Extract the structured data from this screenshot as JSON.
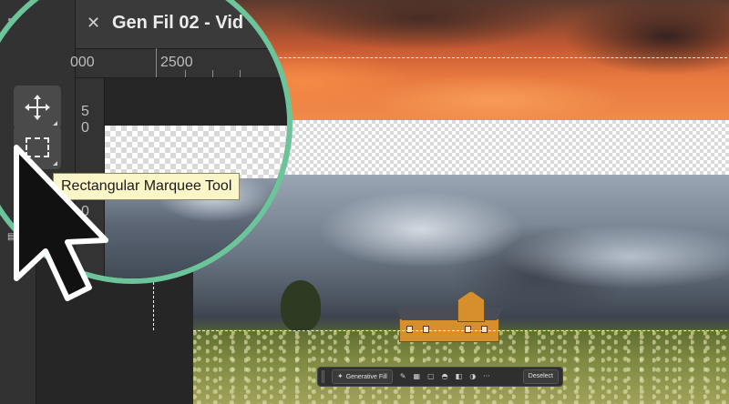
{
  "document": {
    "tab_title": "Gen Fil 02 - Vid",
    "close_icon": "close-icon"
  },
  "ruler": {
    "horizontal_ticks": [
      "000",
      "2500"
    ],
    "vertical_ticks": [
      "5",
      "0",
      "0"
    ]
  },
  "tools": {
    "move_tool_icon": "move-icon",
    "marquee_tool_icon": "rectangular-marquee-icon",
    "lasso_tool_icon": "lasso-icon"
  },
  "tooltip": {
    "text": "Rectangular Marquee Tool"
  },
  "contextual_task_bar": {
    "generative_fill_label": "Generative Fill",
    "deselect_label": "Deselect",
    "more_label": "···"
  },
  "colors": {
    "magnifier_ring": "#6cc49b",
    "tooltip_bg": "#fbf6c8",
    "panel_bg": "#323232",
    "canvas_bg": "#262626"
  }
}
